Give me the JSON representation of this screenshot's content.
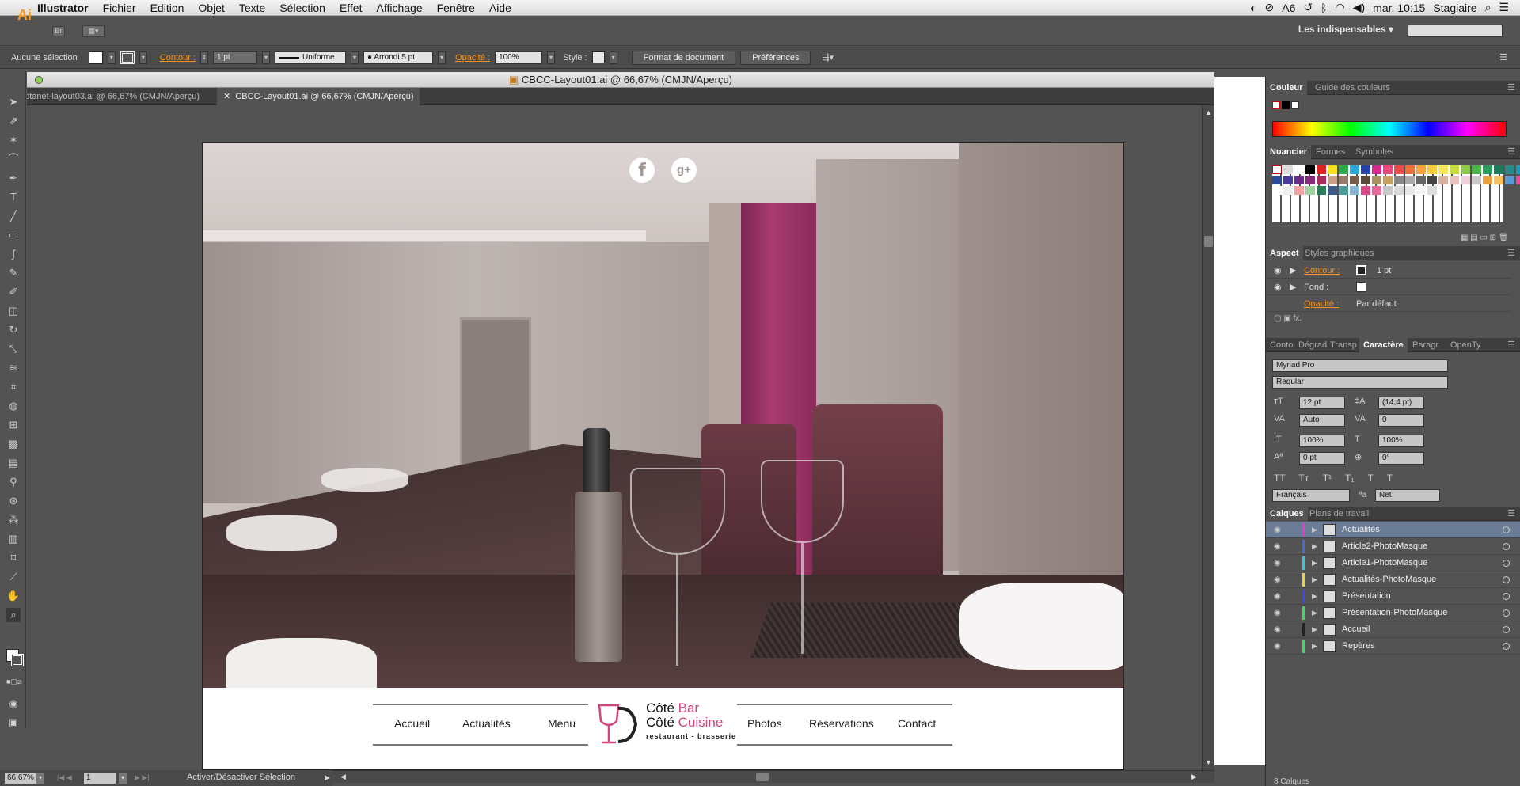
{
  "menubar": {
    "app": "Illustrator",
    "items": [
      "Fichier",
      "Edition",
      "Objet",
      "Texte",
      "Sélection",
      "Effet",
      "Affichage",
      "Fenêtre",
      "Aide"
    ],
    "status_badge": "6",
    "clock": "mar. 10:15",
    "user": "Stagiaire"
  },
  "appbar": {
    "logo": "Ai",
    "bridge_label": "Br",
    "workspace": "Les indispensables"
  },
  "control": {
    "selection": "Aucune sélection",
    "contour_label": "Contour :",
    "contour_value": "1 pt",
    "stroke_profile": "Uniforme",
    "brush": "Arrondi 5 pt",
    "opacity_label": "Opacité :",
    "opacity_value": "100%",
    "style_label": "Style :",
    "doc_format_button": "Format de document",
    "prefs_button": "Préférences"
  },
  "document": {
    "title": "CBCC-Layout01.ai @ 66,67% (CMJN/Aperçu)",
    "tabs": [
      {
        "label": "ptanet-layout03.ai @ 66,67% (CMJN/Aperçu)",
        "active": false
      },
      {
        "label": "CBCC-Layout01.ai @ 66,67% (CMJN/Aperçu)",
        "active": true
      }
    ]
  },
  "artboard": {
    "nav": [
      "Accueil",
      "Actualités",
      "Menu",
      "Photos",
      "Réservations",
      "Contact"
    ],
    "logo_line1a": "Côté ",
    "logo_line1b": "Bar",
    "logo_line2a": "Côté ",
    "logo_line2b": "Cuisine",
    "logo_tagline": "restaurant - brasserie",
    "accent_color": "#d0457f"
  },
  "status": {
    "zoom": "66,67%",
    "artboard_num": "1",
    "toggle": "Activer/Désactiver Sélection"
  },
  "panels": {
    "color_tabs": [
      "Couleur",
      "Guide des couleurs"
    ],
    "swatch_tabs": [
      "Nuancier",
      "Formes",
      "Symboles"
    ],
    "aspect_tabs": [
      "Aspect",
      "Styles graphiques"
    ],
    "aspect_rows": [
      {
        "label": "Contour :",
        "value": "1 pt"
      },
      {
        "label": "Fond :",
        "value": ""
      },
      {
        "label": "Opacité :",
        "value": "Par défaut"
      }
    ],
    "char_tabs": [
      "Conto",
      "Dégrad",
      "Transp",
      "Caractère",
      "Paragr",
      "OpenTy"
    ],
    "font_family": "Myriad Pro",
    "font_style": "Regular",
    "font_size": "12 pt",
    "leading": "(14,4 pt)",
    "kerning": "Auto",
    "tracking": "0",
    "vscale": "100%",
    "hscale": "100%",
    "baseline": "0 pt",
    "rotation": "0°",
    "language": "Français",
    "antialias": "Net",
    "layer_tabs": [
      "Calques",
      "Plans de travail"
    ],
    "layers": [
      {
        "name": "Actualités",
        "color": "#e63cc8",
        "selected": true
      },
      {
        "name": "Article2-PhotoMasque",
        "color": "#4a6bd6",
        "selected": false
      },
      {
        "name": "Article1-PhotoMasque",
        "color": "#36c7e0",
        "selected": false
      },
      {
        "name": "Actualités-PhotoMasque",
        "color": "#e6d43c",
        "selected": false
      },
      {
        "name": "Présentation",
        "color": "#3c4ae6",
        "selected": false
      },
      {
        "name": "Présentation-PhotoMasque",
        "color": "#3cdc5a",
        "selected": false
      },
      {
        "name": "Accueil",
        "color": "#222222",
        "selected": false
      },
      {
        "name": "Repères",
        "color": "#3cdc5a",
        "selected": false
      }
    ],
    "layer_count": "8 Calques"
  }
}
